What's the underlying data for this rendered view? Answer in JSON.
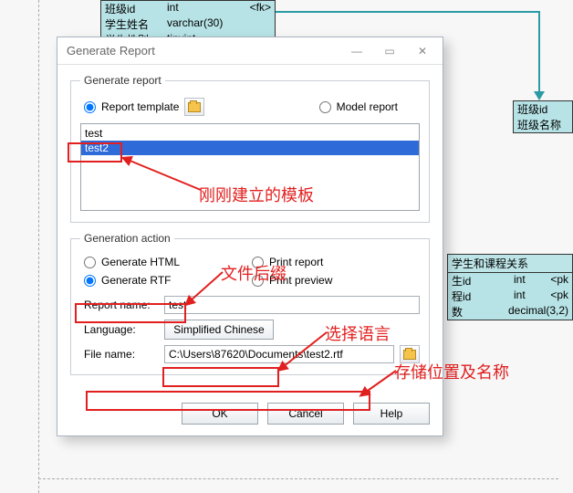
{
  "bg": {
    "table_top": {
      "col1": [
        "班级id",
        "学生姓名",
        "学生性别"
      ],
      "col2": [
        "int",
        "varchar(30)",
        "tinyint"
      ],
      "fk": "<fk>"
    },
    "table_right": {
      "col1": [
        "班级id",
        "班级名称"
      ]
    },
    "table_br": {
      "title": "学生和课程关系",
      "c1": [
        "生id",
        "程id",
        "数"
      ],
      "c2": [
        "int",
        "int",
        "decimal(3,2)"
      ],
      "pk": "<pk"
    }
  },
  "dialog": {
    "title": "Generate Report",
    "group1": {
      "legend": "Generate report",
      "opt_template": "Report template",
      "opt_model": "Model report",
      "items": [
        "test",
        "test2"
      ]
    },
    "group2": {
      "legend": "Generation action",
      "opt_html": "Generate HTML",
      "opt_rtf": "Generate RTF",
      "opt_printr": "Print report",
      "opt_printp": "Print preview",
      "lab_name": "Report name:",
      "val_name": "test",
      "lab_lang": "Language:",
      "val_lang": "Simplified Chinese",
      "lab_file": "File name:",
      "val_file": "C:\\Users\\87620\\Documents\\test2.rtf"
    },
    "buttons": {
      "ok": "OK",
      "cancel": "Cancel",
      "help": "Help"
    }
  },
  "anno": {
    "a1": "刚刚建立的模板",
    "a2": "文件后缀",
    "a3": "选择语言",
    "a4": "存储位置及名称"
  }
}
